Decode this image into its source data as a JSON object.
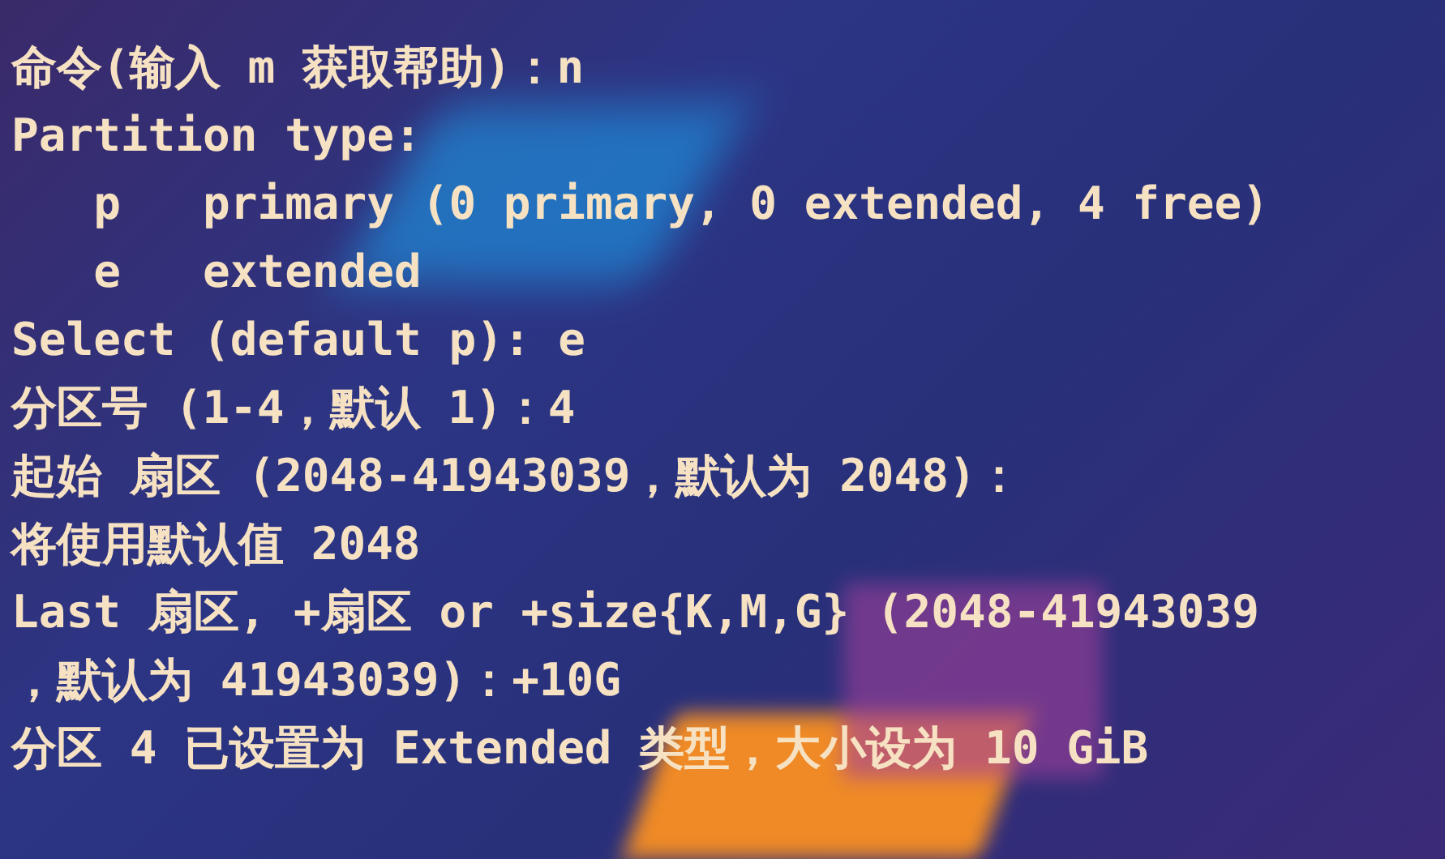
{
  "terminal": {
    "lines": [
      "命令(输入 m 获取帮助)：n",
      "Partition type:",
      "   p   primary (0 primary, 0 extended, 4 free)",
      "   e   extended",
      "Select (default p): e",
      "分区号 (1-4，默认 1)：4",
      "起始 扇区 (2048-41943039，默认为 2048)：",
      "将使用默认值 2048",
      "Last 扇区, +扇区 or +size{K,M,G} (2048-41943039",
      "，默认为 41943039)：+10G",
      "分区 4 已设置为 Extended 类型，大小设为 10 GiB"
    ]
  }
}
